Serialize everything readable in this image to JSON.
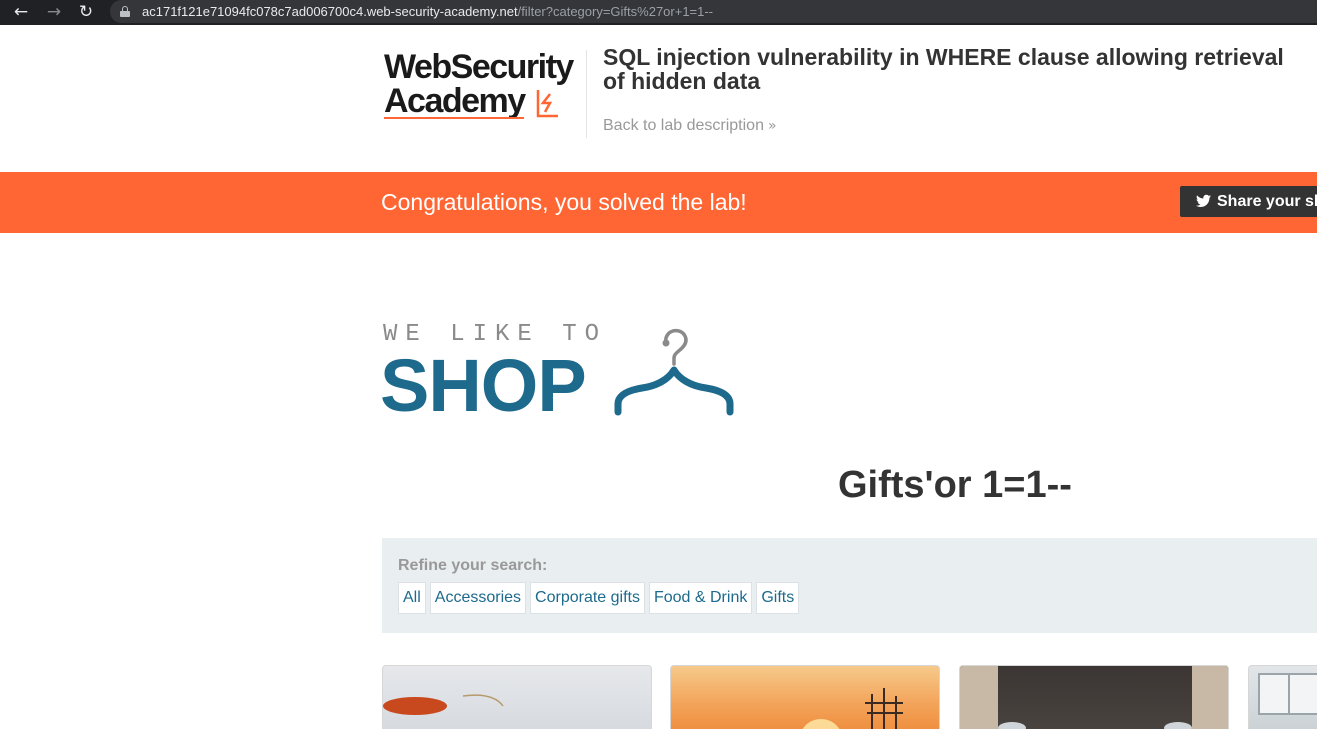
{
  "browser": {
    "url_host": "ac171f121e71094fc078c7ad006700c4.web-security-academy.net",
    "url_path": "/filter?category=Gifts%27or+1=1--",
    "nav": {
      "back": "back-arrow-icon",
      "forward": "forward-arrow-icon",
      "reload": "reload-icon",
      "lock": "lock-icon"
    }
  },
  "lab_header": {
    "logo_line1": "WebSecurity",
    "logo_line2": "Academy",
    "title": "SQL injection vulnerability in WHERE clause allowing retrieval of hidden data",
    "back_link": "Back to lab description",
    "back_link_icon": "double-chevron-right-icon"
  },
  "banner": {
    "message": "Congratulations, you solved the lab!",
    "share_label": "Share your sk",
    "share_icon": "twitter-icon",
    "color": "#ff6633"
  },
  "shop_logo": {
    "tagline": "WE LIKE TO",
    "word": "SHOP",
    "icon": "hanger-icon",
    "color": "#1d6a8c"
  },
  "category_heading": "Gifts'or 1=1--",
  "filters": {
    "label": "Refine your search:",
    "links": [
      "All",
      "Accessories",
      "Corporate gifts",
      "Food & Drink",
      "Gifts"
    ]
  },
  "products": [
    {
      "image": "product-image"
    },
    {
      "image": "product-image"
    },
    {
      "image": "product-image"
    },
    {
      "image": "product-image"
    }
  ]
}
